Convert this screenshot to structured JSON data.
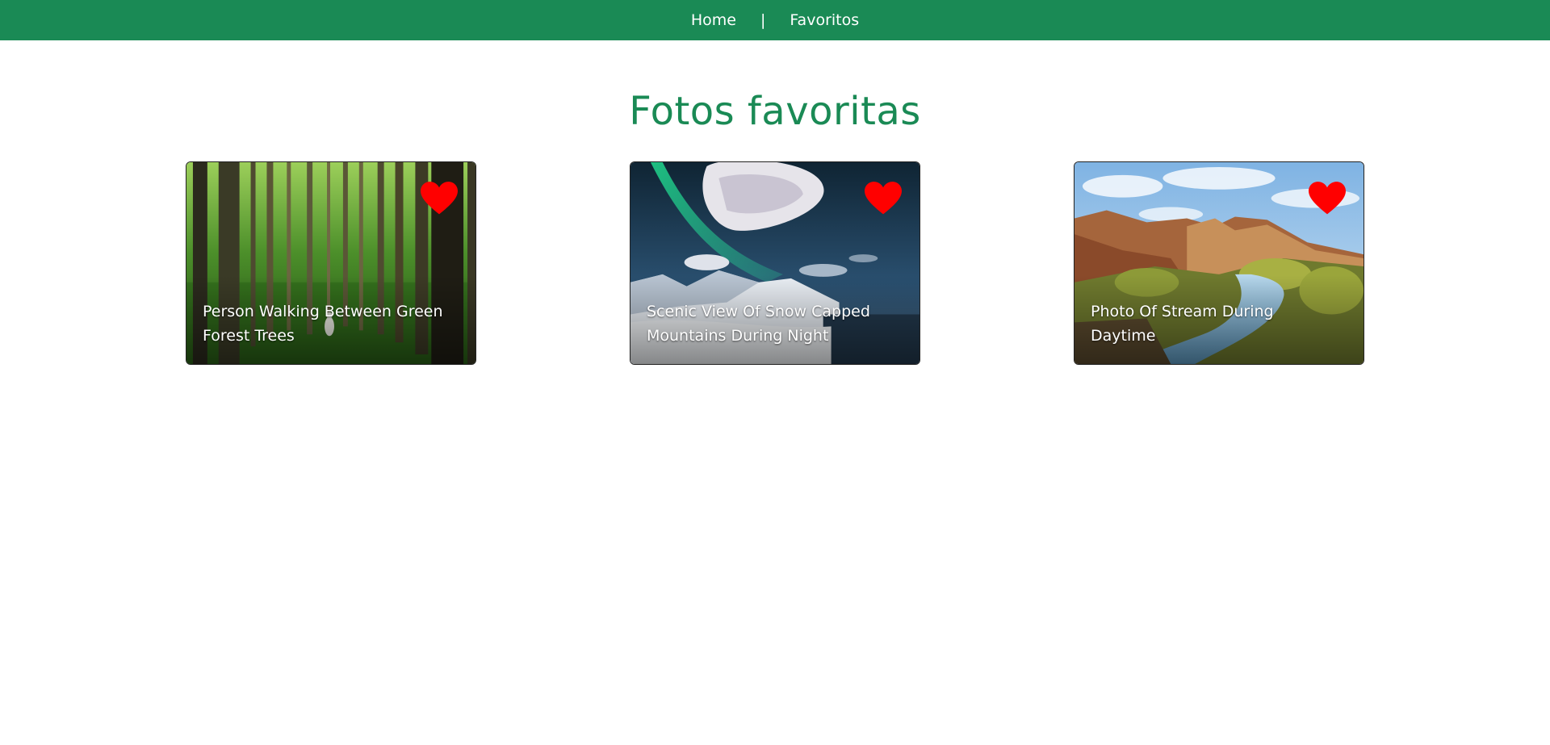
{
  "nav": {
    "home_label": "Home",
    "separator": "|",
    "favorites_label": "Favoritos"
  },
  "page": {
    "title": "Fotos favoritas"
  },
  "colors": {
    "brand_green": "#1a8a55",
    "heart_red": "#ff0000"
  },
  "cards": [
    {
      "caption": "Person Walking Between Green Forest Trees",
      "icon": "heart-icon",
      "favorited": true
    },
    {
      "caption": "Scenic View Of Snow Capped Mountains During Night",
      "icon": "heart-icon",
      "favorited": true
    },
    {
      "caption": "Photo Of Stream During Daytime",
      "icon": "heart-icon",
      "favorited": true
    }
  ]
}
